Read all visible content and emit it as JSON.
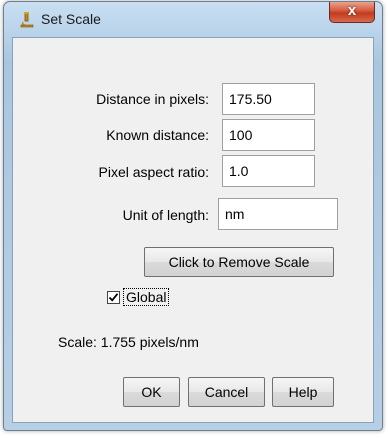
{
  "window": {
    "title": "Set Scale",
    "close_glyph": "x"
  },
  "form": {
    "distance_in_pixels": {
      "label": "Distance in pixels:",
      "value": "175.50"
    },
    "known_distance": {
      "label": "Known distance:",
      "value": "100"
    },
    "pixel_aspect_ratio": {
      "label": "Pixel aspect ratio:",
      "value": "1.0"
    },
    "unit_of_length": {
      "label": "Unit of length:",
      "value": "nm"
    }
  },
  "remove_scale_label": "Click to Remove Scale",
  "global": {
    "label": "Global",
    "checked": true
  },
  "scale_text": "Scale: 1.755 pixels/nm",
  "buttons": {
    "ok": "OK",
    "cancel": "Cancel",
    "help": "Help"
  },
  "icons": {
    "title_icon": "microscope-icon",
    "close_icon": "close-icon",
    "check_icon": "checkmark-icon"
  }
}
